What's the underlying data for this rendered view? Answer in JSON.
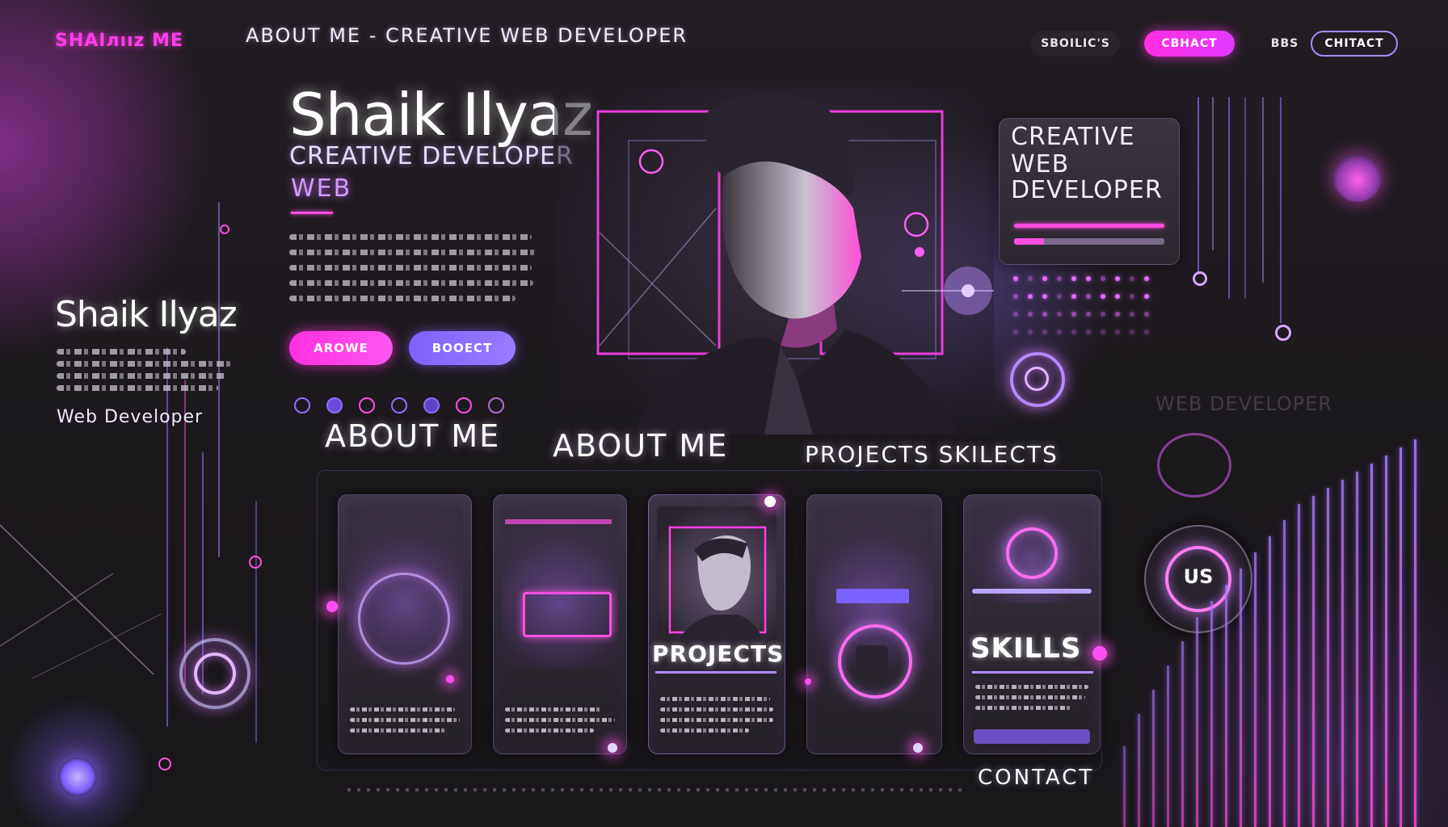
{
  "header": {
    "logo": "SHAIлıız ME",
    "title": "ABOUT ME  -  CREATIVE WEB DEVELOPER",
    "nav": {
      "item1": "SBOILIC'S",
      "item2": "CBHACT",
      "item3": "BBS",
      "item4": "CHITACT"
    }
  },
  "hero": {
    "name": "Shaik Ilyaz",
    "subtitle": "CREATIVE DEVELOPER",
    "subtitle2": "WEB",
    "btn_about": "AROWE",
    "btn_contact": "BOOECT"
  },
  "sidebar": {
    "name": "Shaik Ilyaz",
    "role": "Web Developer"
  },
  "right_panel": {
    "line1": "CREATIVE",
    "line2": "WEB",
    "line3": "DEVELOPER",
    "faint": "WEB DEVELOPER",
    "badge": "US"
  },
  "sections": {
    "about_left": "ABOUT ME",
    "about_center": "ABOUT ME",
    "projects_skills": "PROJECTS  SKILECTS",
    "contact": "CONTACT"
  },
  "cards": {
    "projects": "PROJECTS",
    "skills": "SKILLS"
  },
  "colors": {
    "accent_pink": "#ff3de8",
    "accent_violet": "#8e6bff",
    "background": "#1b181c"
  },
  "icons": {
    "portrait": "developer-portrait",
    "orbs": "glowing-orb-icon",
    "rings": "neon-ring-icon"
  }
}
